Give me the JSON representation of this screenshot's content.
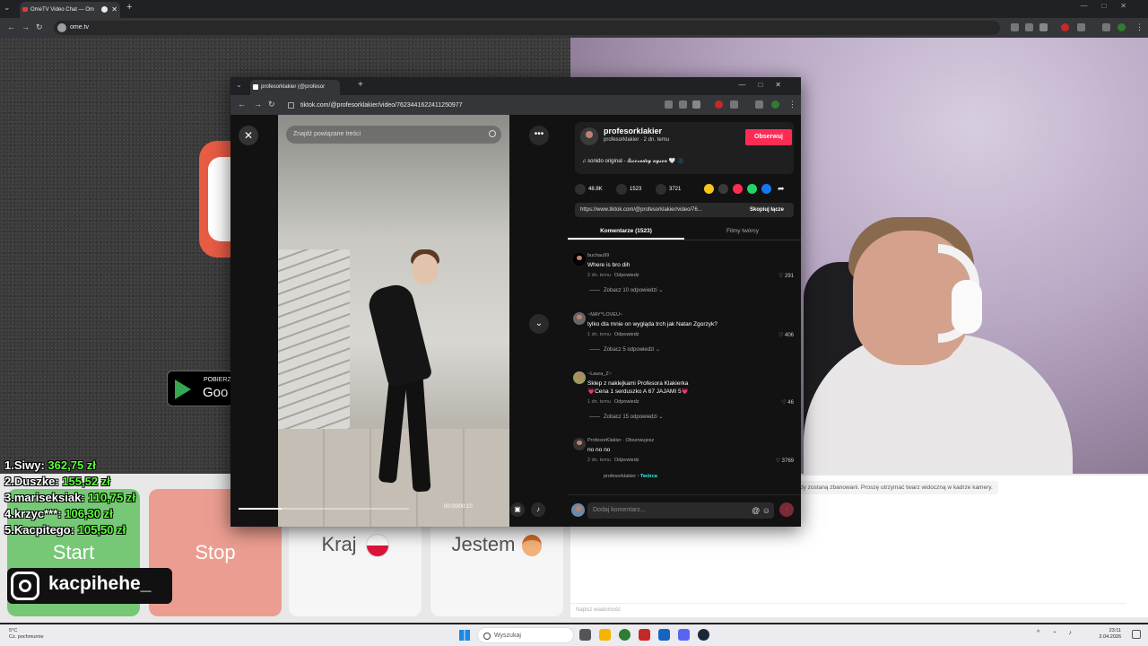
{
  "browser": {
    "tab_title": "OmeTV Video Chat — Om",
    "url": "ome.tv"
  },
  "popup": {
    "tab_title": "profesorklakier (@profesor",
    "url": "tiktok.com/@profesorklakier/video/7623441622411250977"
  },
  "tiktok": {
    "search_placeholder": "Znajdź powiązane treści",
    "close_icon": "✕",
    "more_icon": "•••",
    "next_icon": "⌄",
    "progress": 0.25,
    "timecode": "00:00/00:10",
    "author": {
      "username": "profesorklakier",
      "meta": "profesorklakier · 2 dn. temu",
      "follow_label": "Obserwuj",
      "music": "♫  sonido original - 𝓔𝓼𝓬𝓸𝓿𝓮𝓭𝓮𝔂 𝓪𝔂𝓼𝓮𝓷 🤍 🌑"
    },
    "stats": {
      "likes": "48.8K",
      "comments": "1523",
      "saves": "3721"
    },
    "share_colors": [
      "#f5c518",
      "#3a3a3a",
      "#fe2c55",
      "#25d366",
      "#1877f2"
    ],
    "link": "https://www.tiktok.com/@profesorklakier/video/76...",
    "copy_label": "Skopiuj łącze",
    "tabs": [
      "Komentarze (1523)",
      "Filmy twórcy"
    ],
    "comments": [
      {
        "user": "buchau99",
        "text": "Where is bro dih",
        "time": "2 dn. temu",
        "reply": "Odpowiedz",
        "likes": "♡ 291",
        "more": "Zobacz 10 odpowiedzi ⌄"
      },
      {
        "user": "~MAY^LOVEU~",
        "text": "tylko dla mnie on wygląda trch jak Natan Zgorzyk?",
        "time": "1 dn. temu",
        "reply": "Odpowiedz",
        "likes": "♡ 406",
        "more": "Zobacz 5 odpowiedzi ⌄"
      },
      {
        "user": "~Laura_Z~",
        "text": "Sklep z naklejkami Profesora Klakierka",
        "text2": "💗Cena 1 serduszko A 67 JAJAMI 5💗",
        "time": "1 dn. temu",
        "reply": "Odpowiedz",
        "likes": "♡ 46",
        "more": "Zobacz 15 odpowiedzi ⌄"
      },
      {
        "user": "ProfesorKlakier · Obserwujesz",
        "text": "no no no",
        "time": "2 dn. temu",
        "reply": "Odpowiedz",
        "likes": "♡ 3769",
        "sub_user": "profesorklakier",
        "sub_badge": " · Twórca"
      }
    ],
    "comment_placeholder": "Dodaj komentarz..."
  },
  "ometv": {
    "download_small": "POBIERZ",
    "download_big": "Goo",
    "start_label": "Start",
    "stop_label": "Stop",
    "kraj_label": "Kraj",
    "jestem_label": "Jestem",
    "chat_notice": "dy zostaną zbanowani. Proszę utrzymać twarz widoczną w kadrze kamery.",
    "chat_placeholder": "Napisz wiadomość"
  },
  "leaderboard": [
    {
      "name": "1.Siwy:",
      "amount": "362,75 zł"
    },
    {
      "name": "2.Duszke:",
      "amount": "155,52 zł"
    },
    {
      "name": "3.mariseksiak:",
      "amount": "110,75 zł"
    },
    {
      "name": "4.krzyc***:",
      "amount": "106,30 zł"
    },
    {
      "name": "5.Kacpitego:",
      "amount": "105,50 zł"
    }
  ],
  "instagram": {
    "handle": "kacpihehe_"
  },
  "taskbar": {
    "weather_temp": "5°C",
    "weather_desc": "Cz. pochmurnie",
    "search_label": "Wyszukaj",
    "time": "23:11",
    "date": "2.04.2026",
    "app_colors": [
      "#555555",
      "#f4b400",
      "#2e7d32",
      "#c62828",
      "#1565c0",
      "#5865f2",
      "#1b2838"
    ]
  }
}
